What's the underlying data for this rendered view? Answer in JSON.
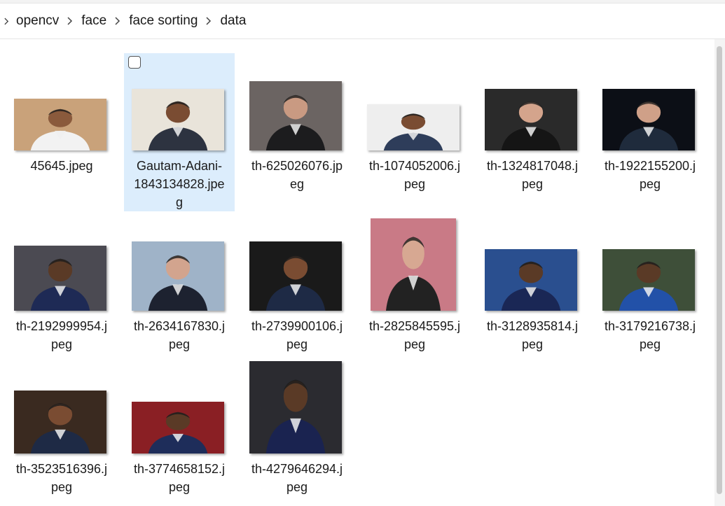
{
  "breadcrumb": {
    "items": [
      "opencv",
      "face",
      "face sorting",
      "data"
    ]
  },
  "files": [
    {
      "name": "45645.jpeg",
      "display": "45645.jpeg",
      "bg": "#c9a27a",
      "suit": "#f2f2f2",
      "skin": "#8a5a3c"
    },
    {
      "name": "Gautam-Adani-1843134828.jpeg",
      "display": "Gautam-Adani-\n1843134828.jpe\ng",
      "bg": "#e9e4da",
      "suit": "#2d3340",
      "skin": "#7a4c32"
    },
    {
      "name": "th-625026076.jpeg",
      "display": "th-625026076.jp\neg",
      "bg": "#6b6462",
      "suit": "#1c1c1e",
      "skin": "#c99a82"
    },
    {
      "name": "th-1074052006.jpeg",
      "display": "th-1074052006.j\npeg",
      "bg": "#eeeeee",
      "suit": "#2e3d5a",
      "skin": "#7a4c32"
    },
    {
      "name": "th-1324817048.jpeg",
      "display": "th-1324817048.j\npeg",
      "bg": "#2a2a2a",
      "suit": "#151515",
      "skin": "#d4a48c"
    },
    {
      "name": "th-1922155200.jpeg",
      "display": "th-1922155200.j\npeg",
      "bg": "#0c0f16",
      "suit": "#1f2b3c",
      "skin": "#cfa088"
    },
    {
      "name": "th-2192999954.jpeg",
      "display": "th-2192999954.j\npeg",
      "bg": "#4b4a52",
      "suit": "#1e2a55",
      "skin": "#5a3a26"
    },
    {
      "name": "th-2634167830.jpeg",
      "display": "th-2634167830.j\npeg",
      "bg": "#9fb3c8",
      "suit": "#1d2230",
      "skin": "#d2a48e"
    },
    {
      "name": "th-2739900106.jpeg",
      "display": "th-2739900106.j\npeg",
      "bg": "#1a1a1a",
      "suit": "#1e2a45",
      "skin": "#7a4c32"
    },
    {
      "name": "th-2825845595.jpeg",
      "display": "th-2825845595.j\npeg",
      "bg": "#c97a86",
      "suit": "#222222",
      "skin": "#d7a892"
    },
    {
      "name": "th-3128935814.jpeg",
      "display": "th-3128935814.j\npeg",
      "bg": "#2a4f8f",
      "suit": "#1a2755",
      "skin": "#5a3a26"
    },
    {
      "name": "th-3179216738.jpeg",
      "display": "th-3179216738.j\npeg",
      "bg": "#3e4f39",
      "suit": "#2251a8",
      "skin": "#5a3a26"
    },
    {
      "name": "th-3523516396.jpeg",
      "display": "th-3523516396.j\npeg",
      "bg": "#3a2a20",
      "suit": "#1e2a45",
      "skin": "#7a4c32"
    },
    {
      "name": "th-3774658152.jpeg",
      "display": "th-3774658152.j\npeg",
      "bg": "#8a1f24",
      "suit": "#1e2d5a",
      "skin": "#5a3a26"
    },
    {
      "name": "th-4279646294.jpeg",
      "display": "th-4279646294.j\npeg",
      "bg": "#2b2b30",
      "suit": "#1a2350",
      "skin": "#5a3a26"
    }
  ],
  "selected_file": "Gautam-Adani-1843134828.jpeg"
}
